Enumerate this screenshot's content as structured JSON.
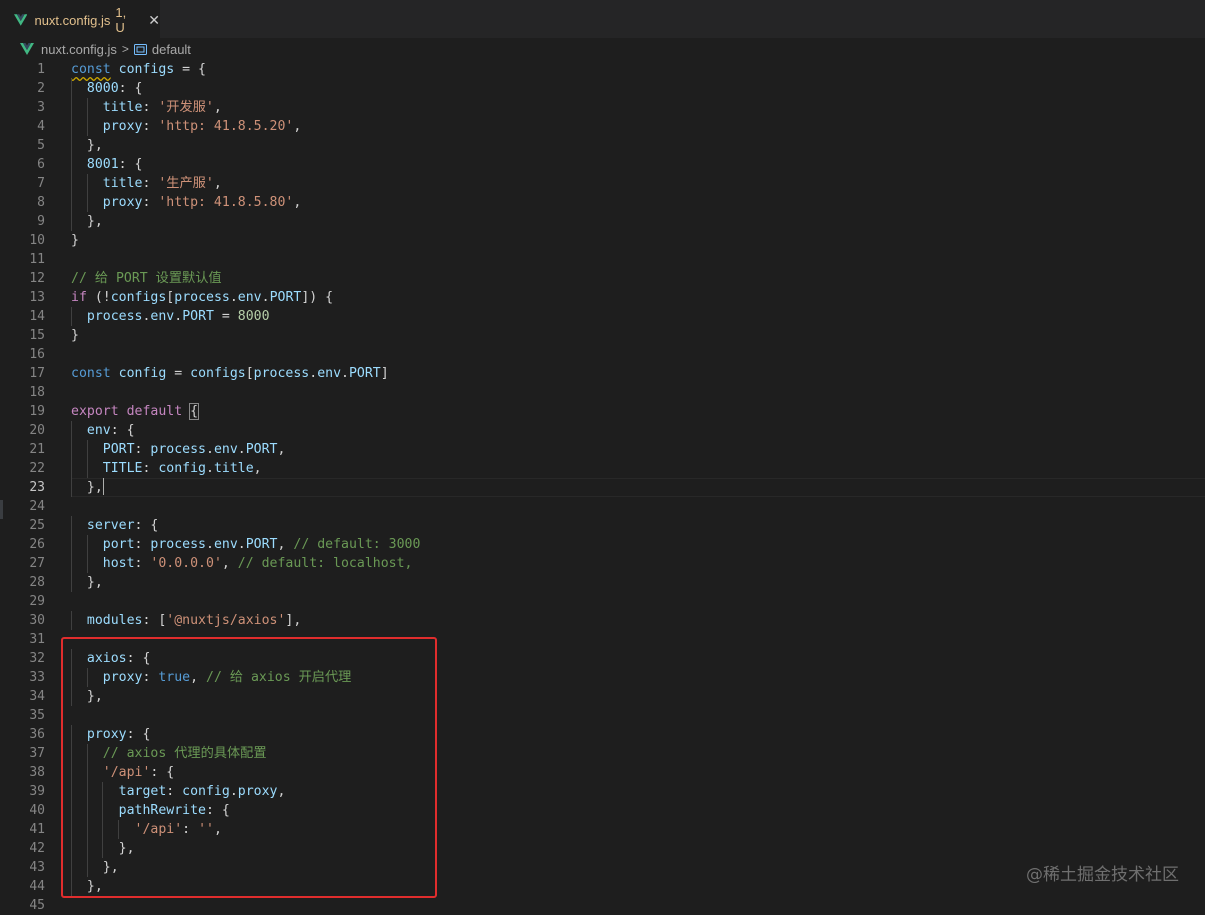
{
  "tab": {
    "file_name": "nuxt.config.js",
    "status": "1, U",
    "close_glyph": "✕",
    "icon": "vue-icon"
  },
  "breadcrumb": {
    "file": "nuxt.config.js",
    "separator": ">",
    "symbol_icon": "symbol-variable-icon",
    "symbol": "default"
  },
  "editor": {
    "active_line": 23,
    "lines": [
      {
        "n": "1",
        "html": "<span class=\"k squiggle\">const</span> <span class=\"v\">configs</span> = {"
      },
      {
        "n": "2",
        "html": "  <span class=\"v\">8000</span>: {"
      },
      {
        "n": "3",
        "html": "    <span class=\"v\">title</span>: <span class=\"s\">'开发服'</span>,"
      },
      {
        "n": "4",
        "html": "    <span class=\"v\">proxy</span>: <span class=\"s\">'http: 41.8.5.20'</span>,"
      },
      {
        "n": "5",
        "html": "  },"
      },
      {
        "n": "6",
        "html": "  <span class=\"v\">8001</span>: {"
      },
      {
        "n": "7",
        "html": "    <span class=\"v\">title</span>: <span class=\"s\">'生产服'</span>,"
      },
      {
        "n": "8",
        "html": "    <span class=\"v\">proxy</span>: <span class=\"s\">'http: 41.8.5.80'</span>,"
      },
      {
        "n": "9",
        "html": "  },"
      },
      {
        "n": "10",
        "html": "}"
      },
      {
        "n": "11",
        "html": ""
      },
      {
        "n": "12",
        "html": "<span class=\"cm\">// 给 PORT 设置默认值</span>"
      },
      {
        "n": "13",
        "html": "<span class=\"c\">if</span> (!<span class=\"v\">configs</span>[<span class=\"v\">process</span>.<span class=\"v\">env</span>.<span class=\"v\">PORT</span>]) {"
      },
      {
        "n": "14",
        "html": "  <span class=\"v\">process</span>.<span class=\"v\">env</span>.<span class=\"v\">PORT</span> = <span class=\"n\">8000</span>"
      },
      {
        "n": "15",
        "html": "}"
      },
      {
        "n": "16",
        "html": ""
      },
      {
        "n": "17",
        "html": "<span class=\"k\">const</span> <span class=\"v\">config</span> = <span class=\"v\">configs</span>[<span class=\"v\">process</span>.<span class=\"v\">env</span>.<span class=\"v\">PORT</span>]"
      },
      {
        "n": "18",
        "html": ""
      },
      {
        "n": "19",
        "html": "<span class=\"c\">export</span> <span class=\"c\">default</span> <span class=\"bracket-box\">{</span>"
      },
      {
        "n": "20",
        "html": "  <span class=\"v\">env</span>: {"
      },
      {
        "n": "21",
        "html": "    <span class=\"v\">PORT</span>: <span class=\"v\">process</span>.<span class=\"v\">env</span>.<span class=\"v\">PORT</span>,"
      },
      {
        "n": "22",
        "html": "    <span class=\"v\">TITLE</span>: <span class=\"v\">config</span>.<span class=\"v\">title</span>,"
      },
      {
        "n": "23",
        "html": "  },<span class=\"caret\"></span>"
      },
      {
        "n": "24",
        "html": ""
      },
      {
        "n": "25",
        "html": "  <span class=\"v\">server</span>: {"
      },
      {
        "n": "26",
        "html": "    <span class=\"v\">port</span>: <span class=\"v\">process</span>.<span class=\"v\">env</span>.<span class=\"v\">PORT</span>, <span class=\"cm\">// default: 3000</span>"
      },
      {
        "n": "27",
        "html": "    <span class=\"v\">host</span>: <span class=\"s\">'0.0.0.0'</span>, <span class=\"cm\">// default: localhost,</span>"
      },
      {
        "n": "28",
        "html": "  },"
      },
      {
        "n": "29",
        "html": ""
      },
      {
        "n": "30",
        "html": "  <span class=\"v\">modules</span>: [<span class=\"s\">'@nuxtjs/axios'</span>],"
      },
      {
        "n": "31",
        "html": ""
      },
      {
        "n": "32",
        "html": "  <span class=\"v\">axios</span>: {"
      },
      {
        "n": "33",
        "html": "    <span class=\"v\">proxy</span>: <span class=\"k\">true</span>, <span class=\"cm\">// 给 axios 开启代理</span>"
      },
      {
        "n": "34",
        "html": "  },"
      },
      {
        "n": "35",
        "html": ""
      },
      {
        "n": "36",
        "html": "  <span class=\"v\">proxy</span>: {"
      },
      {
        "n": "37",
        "html": "    <span class=\"cm\">// axios 代理的具体配置</span>"
      },
      {
        "n": "38",
        "html": "    <span class=\"s\">'/api'</span>: {"
      },
      {
        "n": "39",
        "html": "      <span class=\"v\">target</span>: <span class=\"v\">config</span>.<span class=\"v\">proxy</span>,"
      },
      {
        "n": "40",
        "html": "      <span class=\"v\">pathRewrite</span>: {"
      },
      {
        "n": "41",
        "html": "        <span class=\"s\">'/api'</span>: <span class=\"s\">''</span>,"
      },
      {
        "n": "42",
        "html": "      },"
      },
      {
        "n": "43",
        "html": "    },"
      },
      {
        "n": "44",
        "html": "  },"
      },
      {
        "n": "45",
        "html": ""
      }
    ]
  },
  "watermark": "@稀土掘金技术社区",
  "colors": {
    "keyword": "#569cd6",
    "control": "#c586c0",
    "variable": "#9cdcfe",
    "string": "#ce9178",
    "number": "#b5cea8",
    "comment": "#6a9955",
    "highlight_box": "#e02d2d"
  }
}
